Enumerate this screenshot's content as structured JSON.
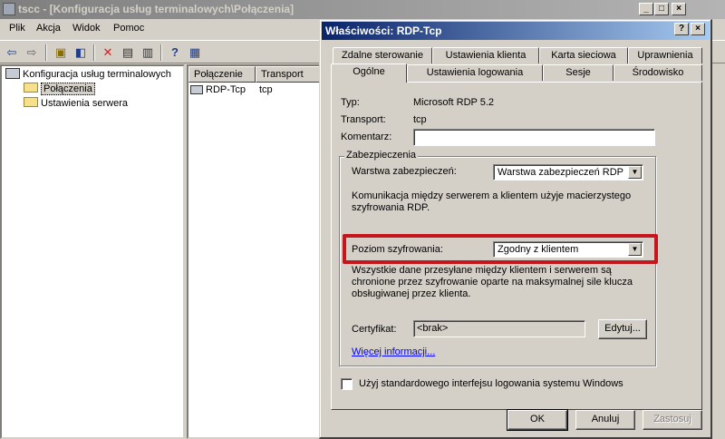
{
  "background_window": {
    "title": "tscc - [Konfiguracja usług terminalowych\\Połączenia]",
    "menu": [
      "Plik",
      "Akcja",
      "Widok",
      "Pomoc"
    ],
    "tree": {
      "root": "Konfiguracja usług terminalowych",
      "children": [
        "Połączenia",
        "Ustawienia serwera"
      ]
    },
    "list": {
      "columns": [
        "Połączenie",
        "Transport"
      ],
      "rows": [
        {
          "connection": "RDP-Tcp",
          "transport": "tcp"
        }
      ]
    }
  },
  "dialog": {
    "title": "Właściwości: RDP-Tcp",
    "tabs_back": [
      "Zdalne sterowanie",
      "Ustawienia klienta",
      "Karta sieciowa",
      "Uprawnienia"
    ],
    "tabs_front": [
      "Ogólne",
      "Ustawienia logowania",
      "Sesje",
      "Środowisko"
    ],
    "active_tab": "Ogólne",
    "type_label": "Typ:",
    "type_value": "Microsoft RDP 5.2",
    "transport_label": "Transport:",
    "transport_value": "tcp",
    "comment_label": "Komentarz:",
    "comment_value": "",
    "security_group": "Zabezpieczenia",
    "security_layer_label": "Warstwa zabezpieczeń:",
    "security_layer_value": "Warstwa zabezpieczeń RDP",
    "security_layer_desc": "Komunikacja między serwerem a klientem użyje macierzystego szyfrowania RDP.",
    "encryption_label": "Poziom szyfrowania:",
    "encryption_value": "Zgodny z klientem",
    "encryption_desc": "Wszystkie dane przesyłane między klientem i serwerem są chronione przez szyfrowanie oparte na maksymalnej sile klucza obsługiwanej przez klienta.",
    "certificate_label": "Certyfikat:",
    "certificate_value": "<brak>",
    "edit_button": "Edytuj...",
    "more_info_link": "Więcej informacji...",
    "windows_logon_checkbox": "Użyj standardowego interfejsu logowania systemu Windows",
    "windows_logon_checked": false,
    "ok_button": "OK",
    "cancel_button": "Anuluj",
    "apply_button": "Zastosuj"
  },
  "colors": {
    "highlight_box": "#c4161c",
    "title_active": "#0a246a",
    "title_inactive": "#7f7f7f"
  }
}
